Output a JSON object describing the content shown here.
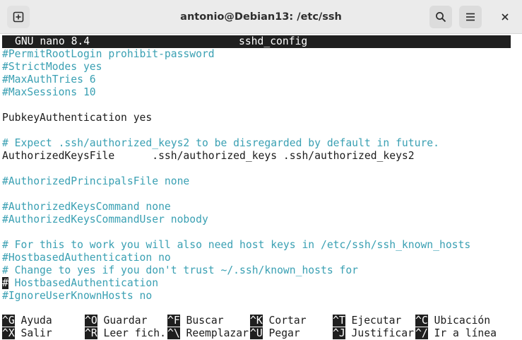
{
  "window": {
    "title": "antonio@Debian13: /etc/ssh"
  },
  "nano": {
    "app": "GNU nano 8.4",
    "file": "sshd_config"
  },
  "lines": [
    {
      "text": "#PermitRootLogin prohibit-password",
      "type": "comment"
    },
    {
      "text": "#StrictModes yes",
      "type": "comment"
    },
    {
      "text": "#MaxAuthTries 6",
      "type": "comment"
    },
    {
      "text": "#MaxSessions 10",
      "type": "comment"
    },
    {
      "text": "",
      "type": "blank"
    },
    {
      "text": "PubkeyAuthentication yes",
      "type": "normal"
    },
    {
      "text": "",
      "type": "blank"
    },
    {
      "text": "# Expect .ssh/authorized_keys2 to be disregarded by default in future.",
      "type": "comment"
    },
    {
      "text": "AuthorizedKeysFile      .ssh/authorized_keys .ssh/authorized_keys2",
      "type": "normal"
    },
    {
      "text": "",
      "type": "blank"
    },
    {
      "text": "#AuthorizedPrincipalsFile none",
      "type": "comment"
    },
    {
      "text": "",
      "type": "blank"
    },
    {
      "text": "#AuthorizedKeysCommand none",
      "type": "comment"
    },
    {
      "text": "#AuthorizedKeysCommandUser nobody",
      "type": "comment"
    },
    {
      "text": "",
      "type": "blank"
    },
    {
      "text": "# For this to work you will also need host keys in /etc/ssh/ssh_known_hosts",
      "type": "comment"
    },
    {
      "text": "#HostbasedAuthentication no",
      "type": "comment"
    },
    {
      "text": "# Change to yes if you don't trust ~/.ssh/known_hosts for",
      "type": "comment"
    },
    {
      "cursor": "#",
      "text": " HostbasedAuthentication",
      "type": "comment"
    },
    {
      "text": "#IgnoreUserKnownHosts no",
      "type": "comment"
    }
  ],
  "shortcuts": [
    [
      {
        "key": "^G",
        "label": " Ayuda"
      },
      {
        "key": "^O",
        "label": " Guardar"
      },
      {
        "key": "^F",
        "label": " Buscar"
      },
      {
        "key": "^K",
        "label": " Cortar"
      },
      {
        "key": "^T",
        "label": " Ejecutar"
      },
      {
        "key": "^C",
        "label": " Ubicación"
      }
    ],
    [
      {
        "key": "^X",
        "label": " Salir"
      },
      {
        "key": "^R",
        "label": " Leer fich."
      },
      {
        "key": "^\\",
        "label": " Reemplazar"
      },
      {
        "key": "^U",
        "label": " Pegar"
      },
      {
        "key": "^J",
        "label": " Justificar"
      },
      {
        "key": "^/",
        "label": " Ir a línea"
      }
    ]
  ]
}
